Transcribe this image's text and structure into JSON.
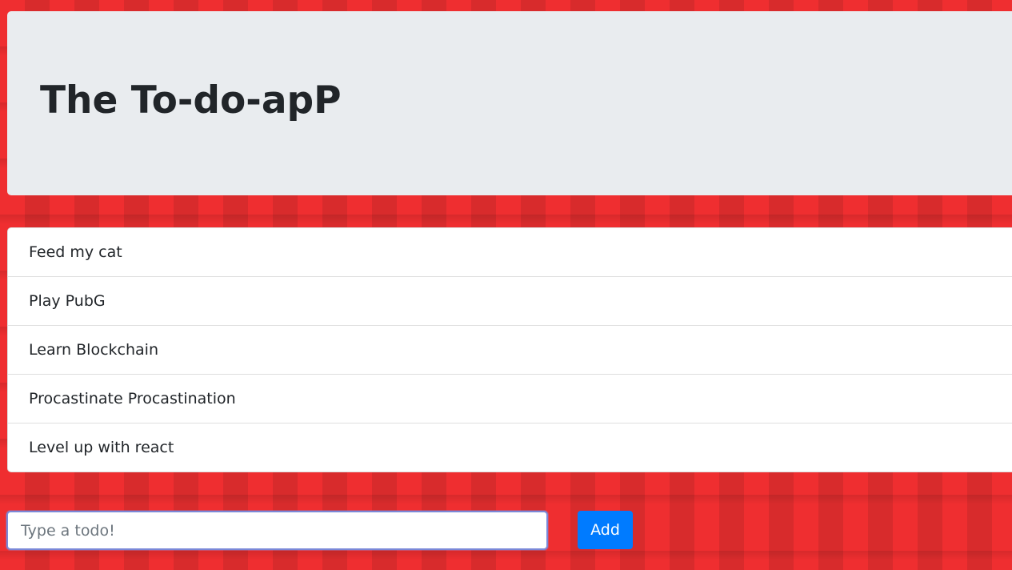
{
  "header": {
    "title": "The To-do-apP"
  },
  "todos": [
    {
      "text": "Feed my cat"
    },
    {
      "text": "Play PubG"
    },
    {
      "text": "Learn Blockchain"
    },
    {
      "text": "Procastinate Procastination"
    },
    {
      "text": "Level up with react"
    }
  ],
  "form": {
    "input_value": "",
    "input_placeholder": "Type a todo!",
    "add_label": "Add"
  },
  "colors": {
    "background": "#e8302f",
    "jumbotron": "#e9ecef",
    "primary": "#007bff",
    "text": "#212529"
  }
}
